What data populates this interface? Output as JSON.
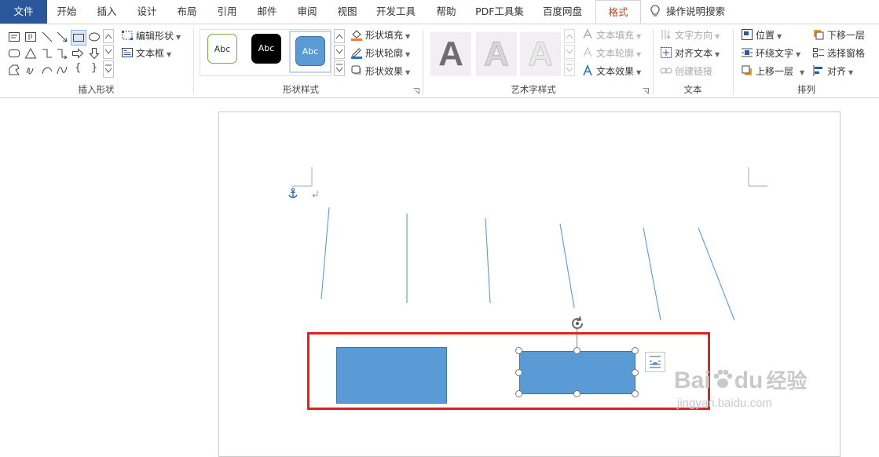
{
  "tabs": [
    {
      "label": "文件"
    },
    {
      "label": "开始"
    },
    {
      "label": "插入"
    },
    {
      "label": "设计"
    },
    {
      "label": "布局"
    },
    {
      "label": "引用"
    },
    {
      "label": "邮件"
    },
    {
      "label": "审阅"
    },
    {
      "label": "视图"
    },
    {
      "label": "开发工具"
    },
    {
      "label": "帮助"
    },
    {
      "label": "PDF工具集"
    },
    {
      "label": "百度网盘"
    },
    {
      "label": "格式"
    }
  ],
  "tell_me": "操作说明搜索",
  "groups": {
    "insert_shapes": {
      "label": "插入形状",
      "edit_shape": "编辑形状",
      "text_box": "文本框",
      "curly_left": "{",
      "curly_right": "}"
    },
    "shape_styles": {
      "label": "形状样式",
      "presets": [
        "Abc",
        "Abc",
        "Abc"
      ],
      "fill": "形状填充",
      "outline": "形状轮廓",
      "effects": "形状效果"
    },
    "wordart": {
      "label": "艺术字样式",
      "letters": [
        "A",
        "A",
        "A"
      ],
      "text_fill": "文本填充",
      "text_outline": "文本轮廓",
      "text_effects": "文本效果"
    },
    "text": {
      "label": "文本",
      "direction": "文字方向",
      "align": "对齐文本",
      "link": "创建链接"
    },
    "arrange": {
      "label": "排列",
      "position": "位置",
      "wrap": "环绕文字",
      "forward": "上移一层",
      "backward": "下移一层",
      "selection_pane": "选择窗格",
      "align": "对齐"
    }
  },
  "watermark": {
    "brand": "Bai",
    "brand2": "du",
    "cn": "经验",
    "url": "jingyan.baidu.com"
  },
  "colors": {
    "accent": "#2b579a",
    "active_tab": "#c43e1c",
    "shape_fill": "#5b9bd5",
    "highlight": "#e0221f"
  }
}
